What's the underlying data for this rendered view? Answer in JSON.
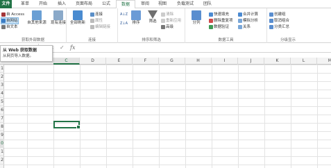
{
  "tabs": [
    "文件",
    "革单",
    "开始",
    "插入",
    "页面布局",
    "公式",
    "数据",
    "审阅",
    "视图",
    "负载测试",
    "团队"
  ],
  "active_tab": "数据",
  "ribbon": {
    "get_external": {
      "access": "自 Access",
      "web": "自网站",
      "text": "自文本",
      "other_sources": "自其他来源",
      "existing": "现有连接",
      "label": "获取外部数据"
    },
    "connections": {
      "refresh_all": "全部刷新",
      "connections": "连接",
      "properties": "属性",
      "edit_links": "编辑链接",
      "label": "连接"
    },
    "sort_filter": {
      "sort_az": "A↓Z",
      "sort_za": "Z↓A",
      "sort": "排序",
      "filter": "筛选",
      "clear": "清除",
      "reapply": "重新应用",
      "advanced": "高级",
      "label": "排序和筛选"
    },
    "data_tools": {
      "text_to_columns": "分列",
      "flash_fill": "快速填充",
      "remove_dup": "删除重复项",
      "validation": "数据验证",
      "consolidate": "合并计算",
      "what_if": "模拟分析",
      "relationships": "关系",
      "label": "数据工具"
    },
    "outline": {
      "group": "创建组",
      "ungroup": "取消组合",
      "subtotal": "分类汇总",
      "label": "分级显示"
    }
  },
  "formula_bar": {
    "cancel": "✕",
    "enter": "✓",
    "fx": "fx"
  },
  "tooltip": {
    "title": "从 Web 获取数据",
    "body": "从网页导入数据。"
  },
  "grid": {
    "columns": [
      "C",
      "D",
      "E",
      "F",
      "G",
      "H",
      "I",
      "J",
      "K",
      "L",
      "M"
    ],
    "selected_column": "C",
    "rows": [
      "1",
      "2",
      "3",
      "4",
      "5",
      "6",
      "7",
      "8",
      "9",
      "0",
      "1",
      "2"
    ],
    "selected_row_index": 9
  }
}
